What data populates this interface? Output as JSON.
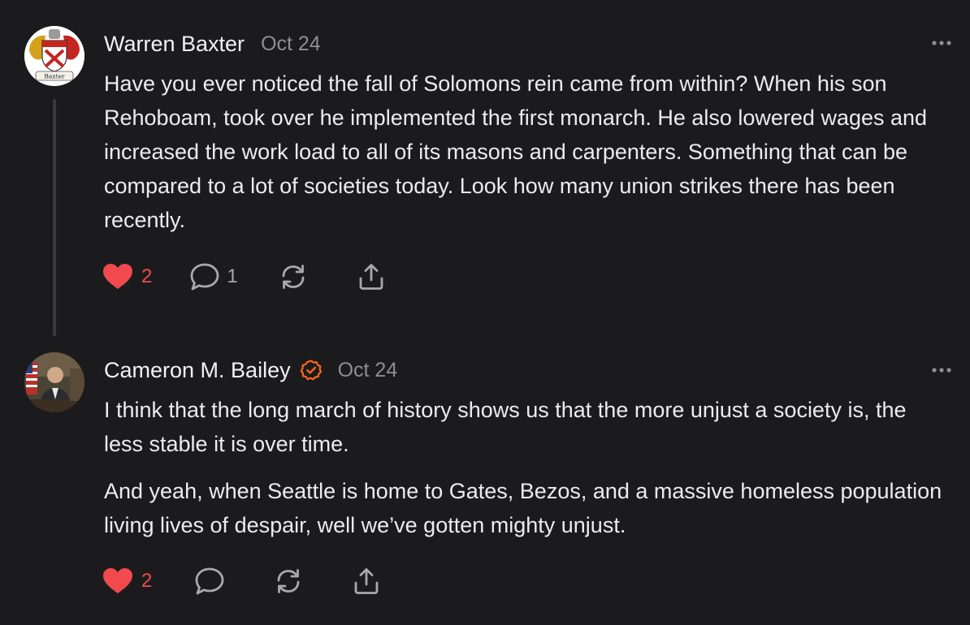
{
  "comments": [
    {
      "author": "Warren Baxter",
      "date": "Oct 24",
      "avatar_text": "Baxter",
      "verified": false,
      "paragraphs": [
        "Have you ever noticed the fall of Solomons rein came from within? When his son Rehoboam, took over he implemented the first monarch. He also lowered wages and increased the work load to all of its masons and carpenters. Something that can be compared to a lot of societies today. Look how many union strikes there has been recently."
      ],
      "likes": "2",
      "liked": true,
      "replies": "1"
    },
    {
      "author": "Cameron M. Bailey",
      "date": "Oct 24",
      "verified": true,
      "paragraphs": [
        "I think that the long march of history shows us that the more unjust a society is, the less stable it is over time.",
        "And yeah, when Seattle is home to Gates, Bezos, and a massive homeless population living lives of despair, well we’ve gotten mighty unjust."
      ],
      "likes": "2",
      "liked": true,
      "replies": ""
    }
  ],
  "colors": {
    "background": "#1b1b1d",
    "text": "#ececec",
    "muted": "#8e8e93",
    "like": "#f04a4f",
    "verified": "#ff6719",
    "thread_line": "#3a3a3d"
  },
  "icons": [
    "heart-icon",
    "comment-icon",
    "restack-icon",
    "share-icon",
    "more-icon",
    "verified-badge-icon"
  ]
}
